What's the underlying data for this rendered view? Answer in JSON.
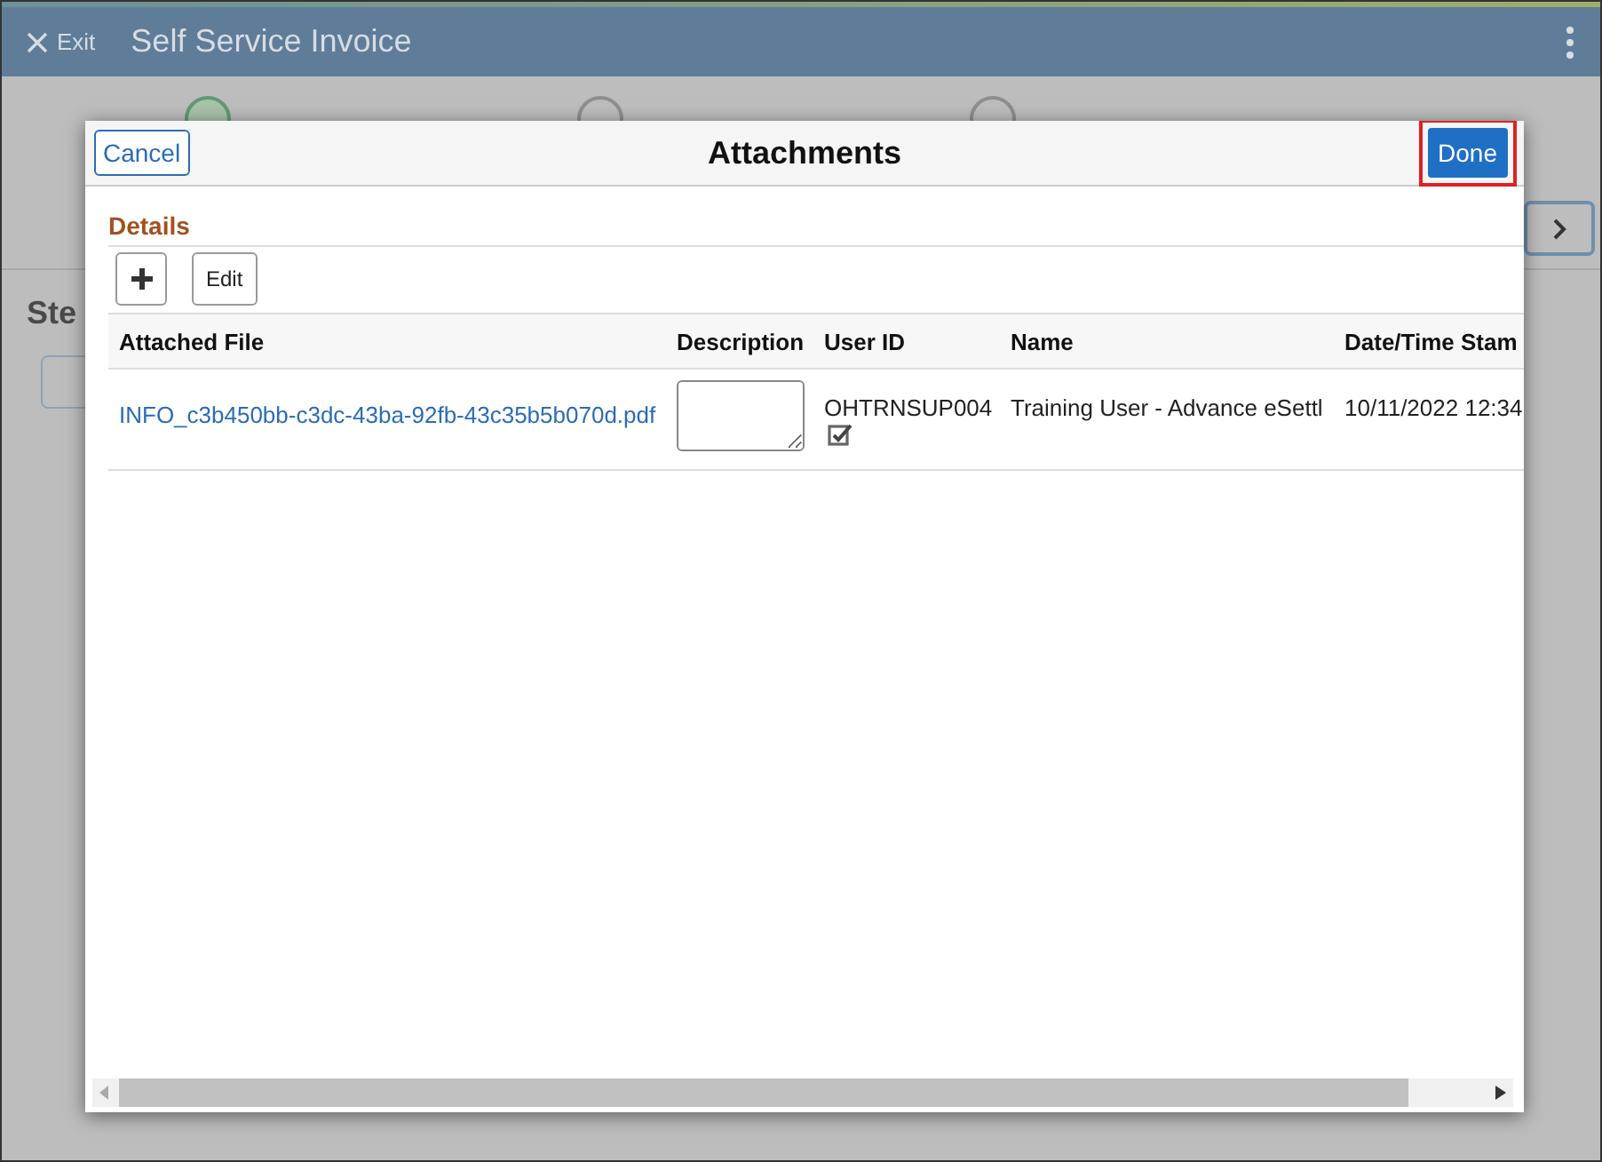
{
  "app_bar": {
    "exit_label": "Exit",
    "title": "Self Service Invoice"
  },
  "steps": [
    {
      "selected": true
    },
    {
      "selected": false
    },
    {
      "selected": false
    }
  ],
  "page": {
    "heading": "Ste"
  },
  "modal": {
    "title": "Attachments",
    "cancel_label": "Cancel",
    "done_label": "Done",
    "done_highlighted": true,
    "section_title": "Details",
    "edit_label": "Edit",
    "columns": [
      "Attached File",
      "Description",
      "User ID",
      "Name",
      "Date/Time Stam"
    ],
    "rows": [
      {
        "attached_file": "INFO_c3b450bb-c3dc-43ba-92fb-43c35b5b070d.pdf",
        "user_id": "OHTRNSUP004",
        "name": "Training User - Advance eSettl",
        "date_time": "10/11/2022 12:34"
      }
    ]
  }
}
